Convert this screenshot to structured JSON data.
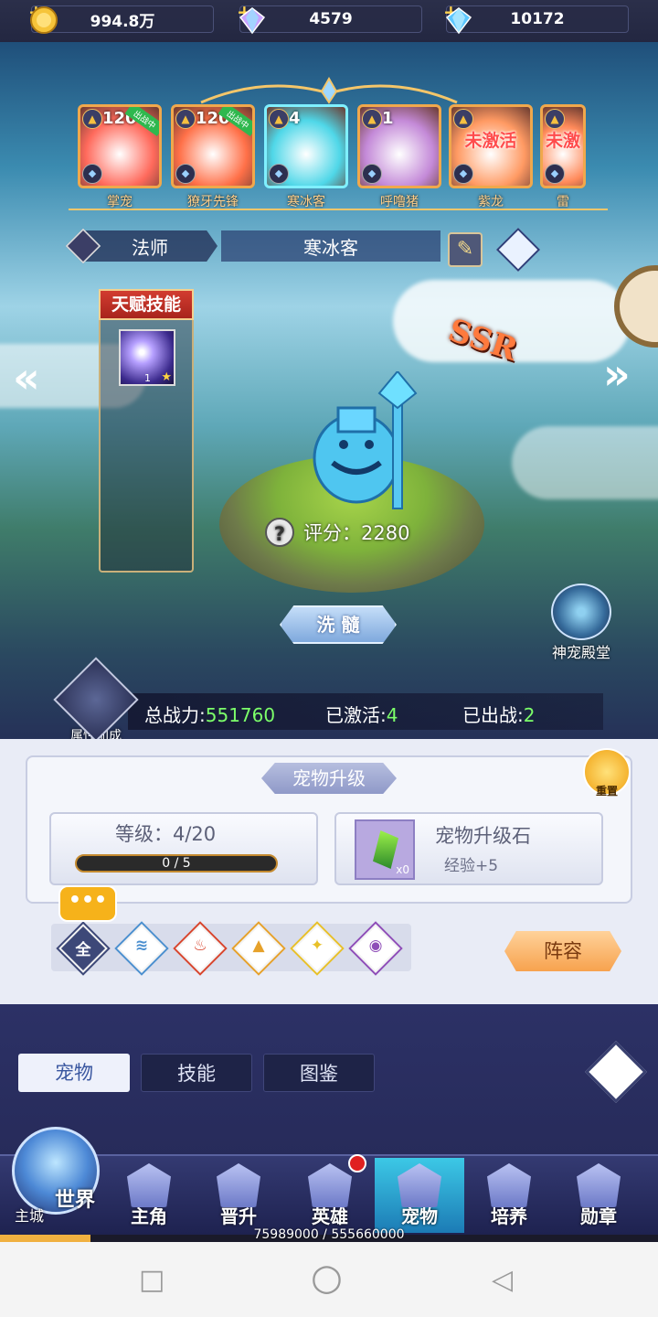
{
  "resources": [
    {
      "icon": "gold-coin-icon",
      "value": "994.8万"
    },
    {
      "icon": "diamond-icon",
      "value": "4579"
    },
    {
      "icon": "blue-diamond-icon",
      "value": "10172"
    }
  ],
  "pet_cards": [
    {
      "level": "120",
      "name": "掌宠",
      "tag": "出战中",
      "inactive": "",
      "color": "#ff6a5c"
    },
    {
      "level": "120",
      "name": "獠牙先锋",
      "tag": "出战中",
      "inactive": "",
      "color": "#ff7048"
    },
    {
      "level": "4",
      "name": "寒冰客",
      "tag": "",
      "inactive": "",
      "color": "#4fd7e8"
    },
    {
      "level": "1",
      "name": "呼噜猪",
      "tag": "",
      "inactive": "",
      "color": "#c48ad8"
    },
    {
      "level": "",
      "name": "紫龙",
      "tag": "",
      "inactive": "未激活",
      "color": "#ff9a63"
    },
    {
      "level": "",
      "name": "雷",
      "tag": "",
      "inactive": "未激",
      "color": "#ff8a5a"
    }
  ],
  "hero": {
    "class": "法师",
    "name": "寒冰客",
    "grade": "SSR",
    "score": "评分：2280"
  },
  "talent": {
    "title": "天赋技能",
    "skill_level": "1"
  },
  "refine_label": "洗 髓",
  "hall_label": "神宠殿堂",
  "attr_label": "属性加成",
  "stats": {
    "power_label": "总战力:",
    "power_value": "551760",
    "activated_label": "已激活:",
    "activated_value": "4",
    "deployed_label": "已出战:",
    "deployed_value": "2"
  },
  "upgrade": {
    "title": "宠物升级",
    "reset_label": "重置",
    "level_text": "等级：4/20",
    "xp_text": "0 / 5",
    "xp_fraction": 0,
    "stone_name": "宠物升级石",
    "stone_exp": "经验+5",
    "stone_count": "x0"
  },
  "filters": [
    {
      "glyph": "全",
      "icon": "all-filter-icon",
      "color": "#3d4878"
    },
    {
      "glyph": "≋",
      "icon": "water-element-icon",
      "color": "#4b8fcf"
    },
    {
      "glyph": "♨",
      "icon": "fire-element-icon",
      "color": "#d8442c"
    },
    {
      "glyph": "▲",
      "icon": "earth-element-icon",
      "color": "#e6a12a"
    },
    {
      "glyph": "✦",
      "icon": "light-element-icon",
      "color": "#e8c028"
    },
    {
      "glyph": "◉",
      "icon": "dark-element-icon",
      "color": "#8e4db8"
    }
  ],
  "chat_glyph": "•••",
  "lineup_label": "阵容",
  "tabs": [
    "宠物",
    "技能",
    "图鉴"
  ],
  "bottom_nav": {
    "world_label": "世界",
    "world_sub": "主城",
    "items": [
      {
        "label": "主角",
        "icon": "hero-nav-icon"
      },
      {
        "label": "晋升",
        "icon": "promote-nav-icon"
      },
      {
        "label": "英雄",
        "icon": "helmet-nav-icon"
      },
      {
        "label": "宠物",
        "icon": "pet-nav-icon"
      },
      {
        "label": "培养",
        "icon": "train-nav-icon"
      },
      {
        "label": "勋章",
        "icon": "medal-nav-icon"
      }
    ],
    "active_index": 3
  },
  "exp": {
    "text": "75989000 / 555660000",
    "fraction": 0.137
  },
  "system_nav": {
    "square": "□",
    "circle": "○",
    "back": "◁"
  }
}
